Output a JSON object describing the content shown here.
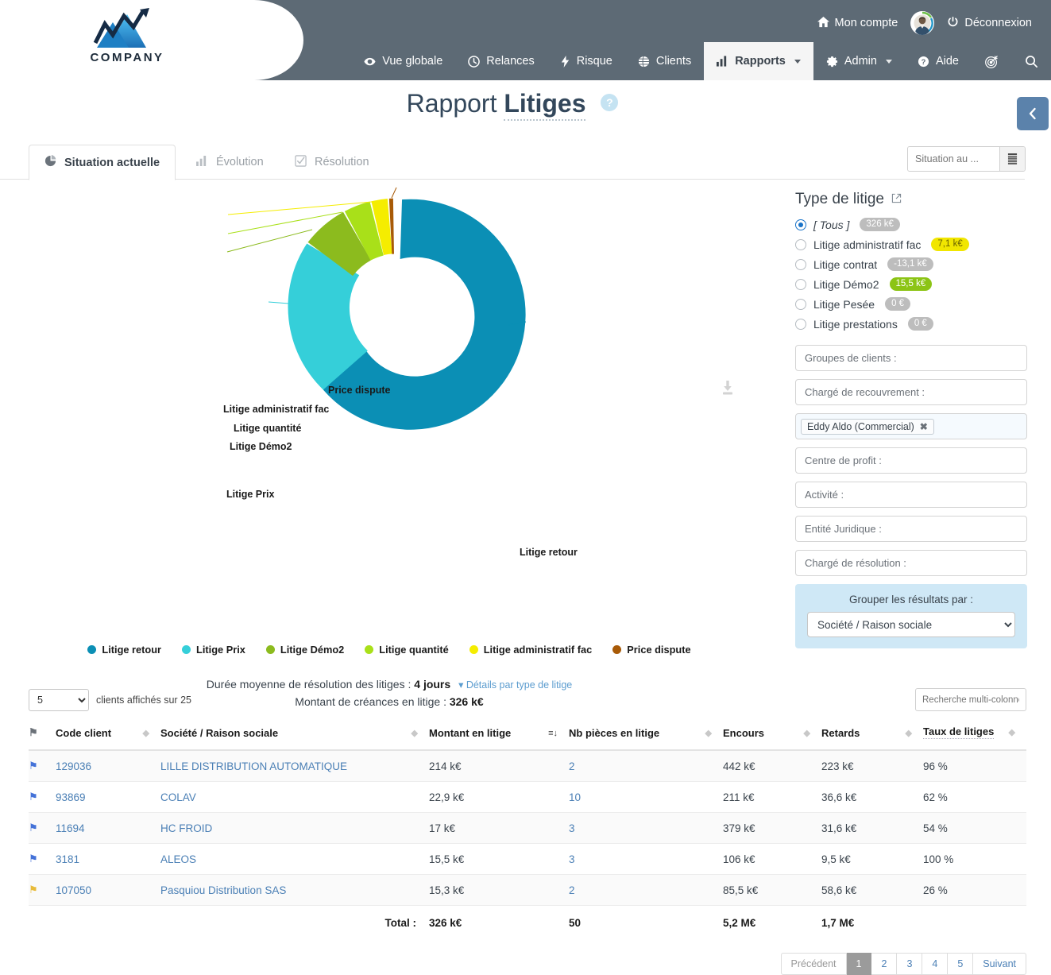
{
  "brand": {
    "name": "COMPANY"
  },
  "topbar": {
    "account_label": "Mon compte",
    "logout_label": "Déconnexion",
    "nav": [
      {
        "label": "Vue globale",
        "icon": "eye-icon",
        "active": false,
        "caret": false
      },
      {
        "label": "Relances",
        "icon": "clock-icon",
        "active": false,
        "caret": false
      },
      {
        "label": "Risque",
        "icon": "bolt-icon",
        "active": false,
        "caret": false
      },
      {
        "label": "Clients",
        "icon": "globe-icon",
        "active": false,
        "caret": false
      },
      {
        "label": "Rapports",
        "icon": "bar-chart-icon",
        "active": true,
        "caret": true
      },
      {
        "label": "Admin",
        "icon": "gear-icon",
        "active": false,
        "caret": true
      },
      {
        "label": "Aide",
        "icon": "question-icon",
        "active": false,
        "caret": false
      }
    ],
    "target_icon": "target-icon",
    "search_icon": "search-icon"
  },
  "page": {
    "title_prefix": "Rapport",
    "title_strong": "Litiges",
    "help_badge": "?",
    "collapse_icon": "chevron-left-icon"
  },
  "tabs": [
    {
      "label": "Situation actuelle",
      "icon": "pie-chart-icon",
      "active": true
    },
    {
      "label": "Évolution",
      "icon": "bar-chart-icon",
      "active": false
    },
    {
      "label": "Résolution",
      "icon": "check-square-icon",
      "active": false
    }
  ],
  "date_filter": {
    "placeholder": "Situation au ...",
    "value": "",
    "icon": "calendar-icon"
  },
  "chart_panel": {
    "download_icon": "download-icon"
  },
  "chart_data": {
    "type": "pie",
    "variant": "donut",
    "title": "",
    "categories": [
      "Litige retour",
      "Litige Prix",
      "Litige Démo2",
      "Litige quantité",
      "Litige administratif fac",
      "Price dispute"
    ],
    "values": [
      196.0,
      92.0,
      15.5,
      11.5,
      7.1,
      1.2
    ],
    "unit": "k€",
    "colors": [
      "#0b8fb5",
      "#35cfd9",
      "#8cbb1e",
      "#a9e019",
      "#f5ed00",
      "#a85a07"
    ],
    "labels": [
      {
        "text": "Litige retour",
        "side": "right"
      },
      {
        "text": "Litige Prix",
        "side": "left"
      },
      {
        "text": "Litige Démo2",
        "side": "left"
      },
      {
        "text": "Litige quantité",
        "side": "left"
      },
      {
        "text": "Litige administratif fac",
        "side": "left"
      },
      {
        "text": "Price dispute",
        "side": "left"
      }
    ],
    "legend": [
      "Litige retour",
      "Litige Prix",
      "Litige Démo2",
      "Litige quantité",
      "Litige administratif fac",
      "Price dispute"
    ],
    "legend_position": "bottom",
    "total": "326 k€"
  },
  "stats": {
    "duration_label": "Durée moyenne de résolution des litiges :",
    "duration_value": "4 jours",
    "details_link": "Détails par type de litige",
    "amount_label": "Montant de créances en litige :",
    "amount_value": "326 k€"
  },
  "filters": {
    "heading": "Type de litige",
    "external_icon": "external-link-icon",
    "litige_types": [
      {
        "label": "[ Tous ]",
        "amount": "326 k€",
        "selected": true,
        "pill": "grey",
        "italic": true
      },
      {
        "label": "Litige administratif fac",
        "amount": "7,1 k€",
        "selected": false,
        "pill": "yellow",
        "italic": false
      },
      {
        "label": "Litige contrat",
        "amount": "-13,1 k€",
        "selected": false,
        "pill": "grey",
        "italic": false
      },
      {
        "label": "Litige Démo2",
        "amount": "15,5 k€",
        "selected": false,
        "pill": "green",
        "italic": false
      },
      {
        "label": "Litige Pesée",
        "amount": "0 €",
        "selected": false,
        "pill": "grey",
        "italic": false
      },
      {
        "label": "Litige prestations",
        "amount": "0 €",
        "selected": false,
        "pill": "grey",
        "italic": false
      }
    ],
    "fields": [
      {
        "label": "Groupes de clients :",
        "name": "groupes-de-clients"
      },
      {
        "label": "Chargé de recouvrement :",
        "name": "charge-de-recouvrement"
      }
    ],
    "token_field": {
      "token": "Eddy Aldo (Commercial)",
      "remove_icon": "close-icon"
    },
    "fields2": [
      {
        "label": "Centre de profit :",
        "name": "centre-de-profit"
      },
      {
        "label": "Activité :",
        "name": "activite"
      },
      {
        "label": "Entité Juridique :",
        "name": "entite-juridique"
      },
      {
        "label": "Chargé de résolution :",
        "name": "charge-de-resolution"
      }
    ],
    "group_by": {
      "label": "Grouper les résultats par :",
      "value": "Société / Raison sociale"
    }
  },
  "table": {
    "rows_per_page": "5",
    "rows_note": "clients affichés sur 25",
    "search_placeholder": "Recherche multi-colonnes",
    "columns": [
      {
        "label": "",
        "name": "flag",
        "sortable": false
      },
      {
        "label": "Code client",
        "name": "code-client",
        "sortable": true,
        "sorted": false
      },
      {
        "label": "Société / Raison sociale",
        "name": "societe",
        "sortable": true,
        "sorted": false
      },
      {
        "label": "Montant en litige",
        "name": "montant-en-litige",
        "sortable": true,
        "sorted": true
      },
      {
        "label": "Nb pièces en litige",
        "name": "nb-pieces",
        "sortable": true,
        "sorted": false
      },
      {
        "label": "Encours",
        "name": "encours",
        "sortable": true,
        "sorted": false
      },
      {
        "label": "Retards",
        "name": "retards",
        "sortable": true,
        "sorted": false
      },
      {
        "label": "Taux de litiges",
        "name": "taux-de-litiges",
        "sortable": true,
        "sorted": false
      }
    ],
    "rows": [
      {
        "flag": "blue",
        "code": "129036",
        "societe": "LILLE DISTRIBUTION AUTOMATIQUE",
        "montant": "214 k€",
        "nb": "2",
        "encours": "442 k€",
        "retards": "223 k€",
        "taux": "96 %"
      },
      {
        "flag": "blue",
        "code": "93869",
        "societe": "COLAV",
        "montant": "22,9 k€",
        "nb": "10",
        "encours": "211 k€",
        "retards": "36,6 k€",
        "taux": "62 %"
      },
      {
        "flag": "blue",
        "code": "11694",
        "societe": "HC FROID",
        "montant": "17 k€",
        "nb": "3",
        "encours": "379 k€",
        "retards": "31,6 k€",
        "taux": "54 %"
      },
      {
        "flag": "blue",
        "code": "3181",
        "societe": "ALEOS",
        "montant": "15,5 k€",
        "nb": "3",
        "encours": "106 k€",
        "retards": "9,5 k€",
        "taux": "100 %"
      },
      {
        "flag": "amber",
        "code": "107050",
        "societe": "Pasquiou Distribution SAS",
        "montant": "15,3 k€",
        "nb": "2",
        "encours": "85,5 k€",
        "retards": "58,6 k€",
        "taux": "26 %"
      }
    ],
    "total": {
      "label": "Total :",
      "montant": "326 k€",
      "nb": "50",
      "encours": "5,2 M€",
      "retards": "1,7 M€",
      "taux": ""
    },
    "pager": {
      "prev": "Précédent",
      "pages": [
        "1",
        "2",
        "3",
        "4",
        "5"
      ],
      "current": "1",
      "next": "Suivant"
    }
  }
}
